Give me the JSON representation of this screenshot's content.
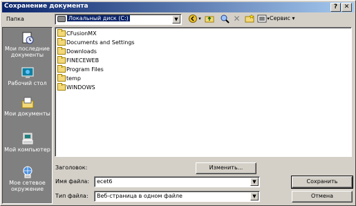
{
  "window": {
    "title": "Сохранение документа",
    "help_label": "?",
    "close_label": "✕"
  },
  "toolbar": {
    "lookin_label": "Папка",
    "lookin_value": "Локальный диск (C:)",
    "service_label": "Сервис ▾"
  },
  "places": [
    {
      "label": "Мои последние документы",
      "icon": "recent-documents-icon"
    },
    {
      "label": "Рабочий стол",
      "icon": "desktop-icon"
    },
    {
      "label": "Мои документы",
      "icon": "my-documents-icon"
    },
    {
      "label": "Мой компьютер",
      "icon": "my-computer-icon"
    },
    {
      "label": "Мое сетевое окружение",
      "icon": "network-icon"
    }
  ],
  "files": [
    {
      "name": "CFusionMX"
    },
    {
      "name": "Documents and Settings"
    },
    {
      "name": "Downloads"
    },
    {
      "name": "FINECEWEB"
    },
    {
      "name": "Program Files"
    },
    {
      "name": "temp"
    },
    {
      "name": "WINDOWS"
    }
  ],
  "form": {
    "heading_label": "Заголовок:",
    "change_button": "Изменить...",
    "filename_label": "Имя файла:",
    "filename_value": "ecet6",
    "filetype_label": "Тип файла:",
    "filetype_value": "Веб-страница в одном файле",
    "save_button": "Сохранить",
    "cancel_button": "Отмена"
  },
  "colors": {
    "titlebar": "#0a246a",
    "face": "#d4d0c8",
    "places_bg": "#808080",
    "folder": "#f3d97a"
  }
}
